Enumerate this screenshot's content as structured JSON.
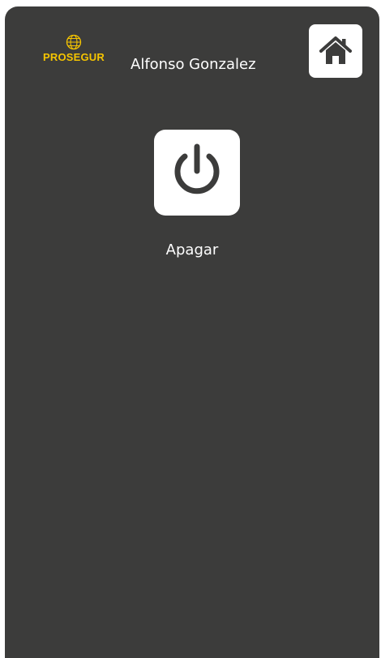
{
  "header": {
    "logo_text": "PROSEGUR",
    "logo_icon": "globe-icon",
    "user_name": "Alfonso Gonzalez",
    "home_icon": "home-icon"
  },
  "main": {
    "power_icon": "power-icon",
    "power_label": "Apagar"
  },
  "colors": {
    "background": "#3c3c3b",
    "brand_yellow": "#f5c400",
    "button_bg": "#ffffff",
    "icon_dark": "#3c3c3b"
  }
}
